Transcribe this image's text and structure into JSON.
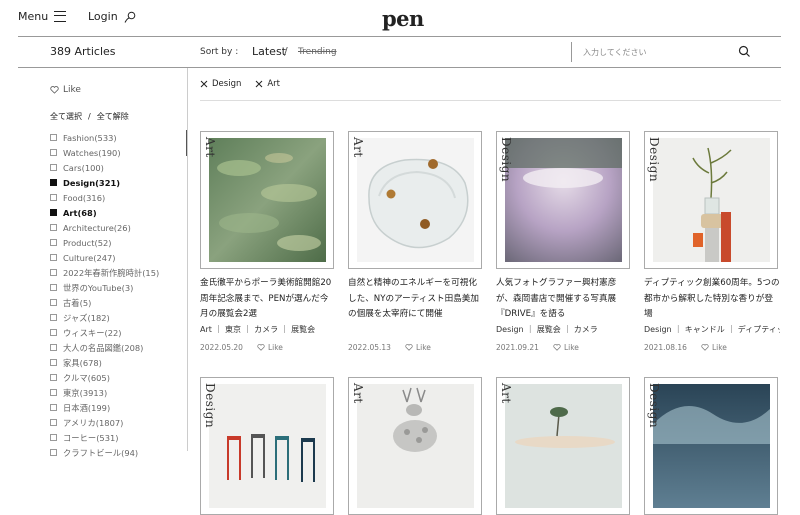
{
  "header": {
    "menu_label": "Menu",
    "login_label": "Login",
    "logo": "pen"
  },
  "sortbar": {
    "count": "389 Articles",
    "sort_label": "Sort by :",
    "latest": "Latest",
    "slash": "/",
    "trending": "Trending",
    "search_placeholder": "入力してください"
  },
  "sidebar": {
    "like_label": "Like",
    "select_all": "全て選択",
    "slash": "/",
    "deselect_all": "全て解除",
    "categories": [
      {
        "label": "Fashion(533)",
        "checked": false
      },
      {
        "label": "Watches(190)",
        "checked": false
      },
      {
        "label": "Cars(100)",
        "checked": false
      },
      {
        "label": "Design(321)",
        "checked": true
      },
      {
        "label": "Food(316)",
        "checked": false
      },
      {
        "label": "Art(68)",
        "checked": true
      },
      {
        "label": "Architecture(26)",
        "checked": false
      },
      {
        "label": "Product(52)",
        "checked": false
      },
      {
        "label": "Culture(247)",
        "checked": false
      },
      {
        "label": "2022年春新作腕時計(15)",
        "checked": false
      },
      {
        "label": "世界のYouTube(3)",
        "checked": false
      },
      {
        "label": "古着(5)",
        "checked": false
      },
      {
        "label": "ジャズ(182)",
        "checked": false
      },
      {
        "label": "ウィスキー(22)",
        "checked": false
      },
      {
        "label": "大人の名品図鑑(208)",
        "checked": false
      },
      {
        "label": "家具(678)",
        "checked": false
      },
      {
        "label": "クルマ(605)",
        "checked": false
      },
      {
        "label": "東京(3913)",
        "checked": false
      },
      {
        "label": "日本酒(199)",
        "checked": false
      },
      {
        "label": "アメリカ(1807)",
        "checked": false
      },
      {
        "label": "コーヒー(531)",
        "checked": false
      },
      {
        "label": "クラフトビール(94)",
        "checked": false
      }
    ]
  },
  "filters": [
    {
      "label": "Design"
    },
    {
      "label": "Art"
    }
  ],
  "cards": [
    {
      "category": "Art",
      "title": "金氏徹平からポーラ美術館開館20周年記念展まで、PENが選んだ今月の展覧会2選",
      "tags": "Art ｜ 東京 ｜ カメラ ｜ 展覧会",
      "date": "2022.05.20",
      "like": "Like"
    },
    {
      "category": "Art",
      "title": "自然と精神のエネルギーを可視化した、NYのアーティスト田島美加の個展を太宰府にて開催",
      "tags": "",
      "date": "2022.05.13",
      "like": "Like"
    },
    {
      "category": "Design",
      "title": "人気フォトグラファー興村憲彦が、森岡書店で開催する写真展『DRIVE』を語る",
      "tags": "Design ｜ 展覧会 ｜ カメラ",
      "date": "2021.09.21",
      "like": "Like"
    },
    {
      "category": "Design",
      "title": "ディプティック創業60周年。5つの都市から解釈した特別な香りが登場",
      "tags": "Design ｜ キャンドル ｜ ディプティック",
      "date": "2021.08.16",
      "like": "Like"
    },
    {
      "category": "Design",
      "title": "",
      "tags": "",
      "date": "",
      "like": ""
    },
    {
      "category": "Art",
      "title": "",
      "tags": "",
      "date": "",
      "like": ""
    },
    {
      "category": "Art",
      "title": "",
      "tags": "",
      "date": "",
      "like": ""
    },
    {
      "category": "Design",
      "title": "",
      "tags": "",
      "date": "",
      "like": ""
    }
  ]
}
